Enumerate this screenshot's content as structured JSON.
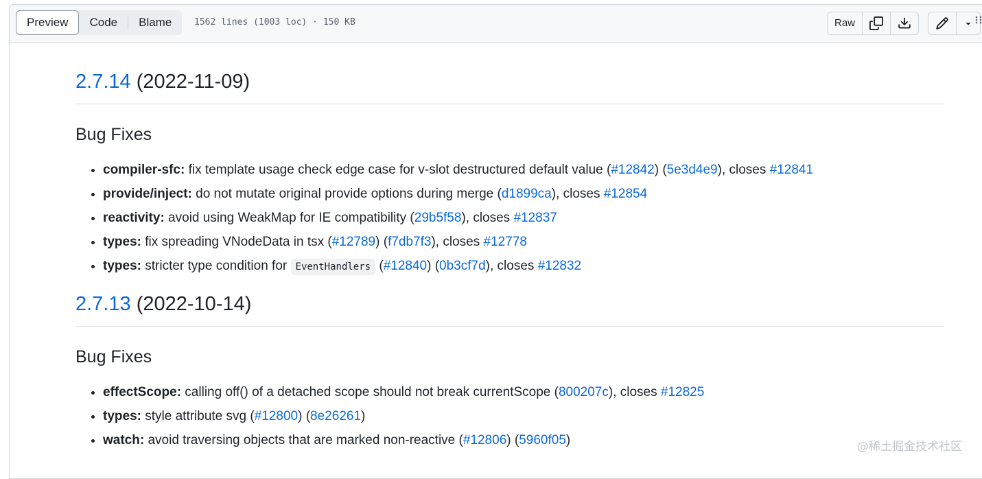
{
  "toolbar": {
    "tabs": [
      {
        "label": "Preview",
        "active": true
      },
      {
        "label": "Code",
        "active": false
      },
      {
        "label": "Blame",
        "active": false
      }
    ],
    "file_meta": "1562 lines (1003 loc) · 150 KB",
    "raw_label": "Raw",
    "copy_icon": "copy-icon",
    "download_icon": "download-icon",
    "edit_icon": "pencil-icon",
    "dropdown_icon": "triangle-down-icon"
  },
  "releases": [
    {
      "version": "2.7.14",
      "date": "(2022-11-09)",
      "section": "Bug Fixes",
      "items": [
        {
          "scope": "compiler-sfc:",
          "text": " fix template usage check edge case for v-slot destructured default value (",
          "pr": "#12842",
          "mid": ") (",
          "commit": "5e3d4e9",
          "closes_pre": "), closes ",
          "closes": "#12841"
        },
        {
          "scope": "provide/inject:",
          "text": " do not mutate original provide options during merge (",
          "commit": "d1899ca",
          "closes_pre": "), closes ",
          "closes": "#12854"
        },
        {
          "scope": "reactivity:",
          "text": " avoid using WeakMap for IE compatibility (",
          "commit": "29b5f58",
          "closes_pre": "), closes ",
          "closes": "#12837"
        },
        {
          "scope": "types:",
          "text": " fix spreading VNodeData in tsx (",
          "pr": "#12789",
          "mid": ") (",
          "commit": "f7db7f3",
          "closes_pre": "), closes ",
          "closes": "#12778"
        },
        {
          "scope": "types:",
          "text": " stricter type condition for ",
          "code": "EventHandlers",
          "text2": " (",
          "pr": "#12840",
          "mid": ") (",
          "commit": "0b3cf7d",
          "closes_pre": "), closes ",
          "closes": "#12832"
        }
      ]
    },
    {
      "version": "2.7.13",
      "date": "(2022-10-14)",
      "section": "Bug Fixes",
      "items": [
        {
          "scope": "effectScope:",
          "text": " calling off() of a detached scope should not break currentScope (",
          "commit": "800207c",
          "closes_pre": "), closes ",
          "closes": "#12825"
        },
        {
          "scope": "types:",
          "text": " style attribute svg (",
          "pr": "#12800",
          "mid": ") (",
          "commit": "8e26261",
          "tail": ")"
        },
        {
          "scope": "watch:",
          "text": " avoid traversing objects that are marked non-reactive (",
          "pr": "#12806",
          "mid": ") (",
          "commit": "5960f05",
          "tail": ")"
        }
      ]
    }
  ],
  "watermark": "@稀土掘金技术社区",
  "colors": {
    "link": "#0969da",
    "border": "#d0d7de",
    "toolbar_bg": "#f6f8fa"
  }
}
